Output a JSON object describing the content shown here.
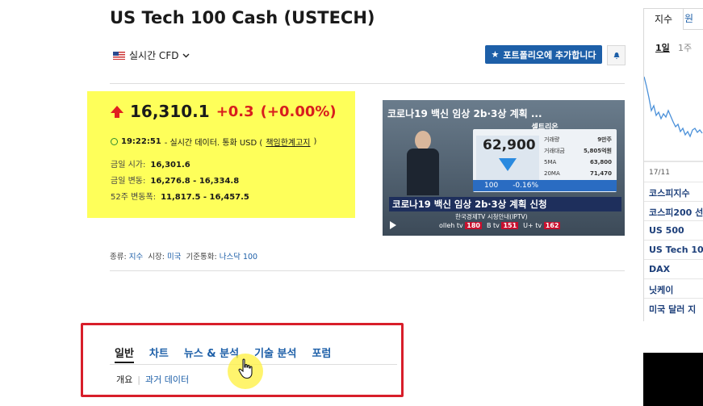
{
  "header": {
    "title": "US Tech 100 Cash (USTECH)",
    "cfd_label": "실시간 CFD",
    "portfolio_button": "포트폴리오에 추가합니다"
  },
  "quote": {
    "price": "16,310.1",
    "change": "+0.3",
    "change_pct": "(+0.00%)",
    "time": "19:22:51",
    "meta_text": "- 실시간 데이터. 통화 USD (",
    "disclaimer_link": "책임한계고지",
    "meta_close": ")",
    "stats": [
      {
        "label": "금일 시가:",
        "value": "16,301.6"
      },
      {
        "label": "금일 변동:",
        "value": "16,276.8 - 16,334.8"
      },
      {
        "label": "52주 변동폭:",
        "value": "11,817.5 - 16,457.5"
      }
    ],
    "colors": {
      "up": "#d81e1e",
      "highlight": "#feff5a"
    }
  },
  "video": {
    "caption_title": "코로나19 백신 임상 2b·3상 계획 ...",
    "company": "셀트리온",
    "stock_price": "62,900",
    "stock_change": "100",
    "stock_change_pct": "-0.16%",
    "rows": [
      {
        "label": "거래량",
        "value": "9만주"
      },
      {
        "label": "거래대금",
        "value": "5,805억원"
      },
      {
        "label": "5MA",
        "value": "63,800"
      },
      {
        "label": "20MA",
        "value": "71,470"
      }
    ],
    "headline": "코로나19 백신 임상 2b·3상 계획 신청",
    "channel_note": "한국경제TV 시청안내(IPTV)",
    "channels": [
      {
        "name": "olleh tv",
        "num": "180"
      },
      {
        "name": "B tv",
        "num": "151"
      },
      {
        "name": "U+ tv",
        "num": "162"
      }
    ]
  },
  "info": {
    "type_label": "종류:",
    "type_value": "지수",
    "market_label": "시장:",
    "market_value": "미국",
    "base_label": "기준통화:",
    "base_value": "나스닥 100"
  },
  "tabs": [
    "일반",
    "차트",
    "뉴스 & 분석",
    "기술 분석",
    "포럼"
  ],
  "subtabs": [
    "개요",
    "과거 데이터"
  ],
  "sidebar": {
    "tab1": "지수",
    "tab2": "원",
    "range1": "1일",
    "range2": "1주",
    "date": "17/11",
    "items": [
      "코스피지수",
      "코스피200 선",
      "US 500",
      "US Tech 100",
      "DAX",
      "닛케이",
      "미국 달러 지"
    ]
  }
}
